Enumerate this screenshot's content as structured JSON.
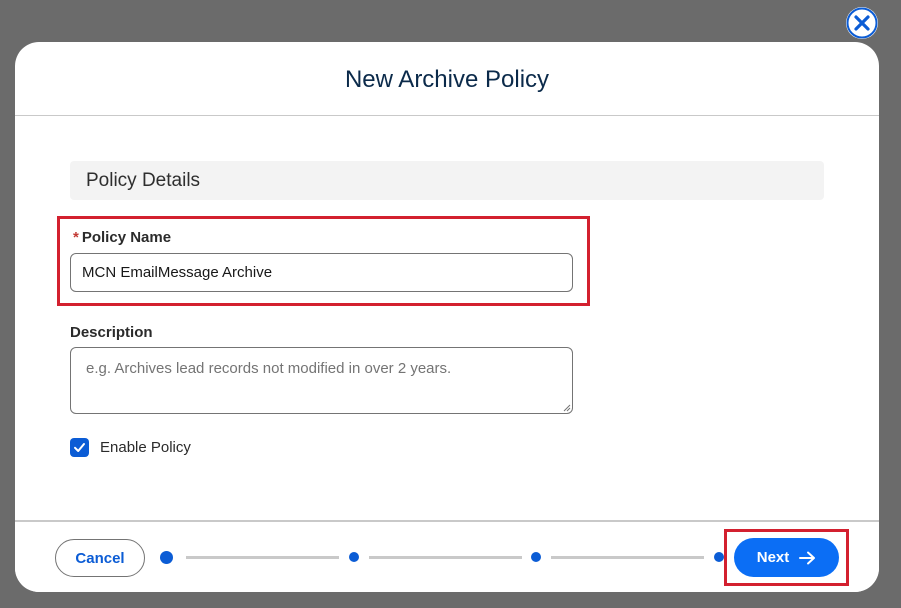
{
  "modal": {
    "title": "New Archive Policy",
    "close_icon": "close-icon"
  },
  "section": {
    "title": "Policy Details"
  },
  "policy_name": {
    "required_marker": "*",
    "label": "Policy Name",
    "value": "MCN EmailMessage Archive"
  },
  "description": {
    "label": "Description",
    "placeholder": "e.g. Archives lead records not modified in over 2 years.",
    "value": ""
  },
  "enable_policy": {
    "label": "Enable Policy",
    "checked": true,
    "icon": "checkmark-icon"
  },
  "footer": {
    "cancel_label": "Cancel",
    "next_label": "Next",
    "next_icon": "arrow-right-icon",
    "steps_total": 4,
    "current_step": 1
  },
  "colors": {
    "brand_blue": "#0b6ef5",
    "highlight_red": "#d3202f"
  }
}
